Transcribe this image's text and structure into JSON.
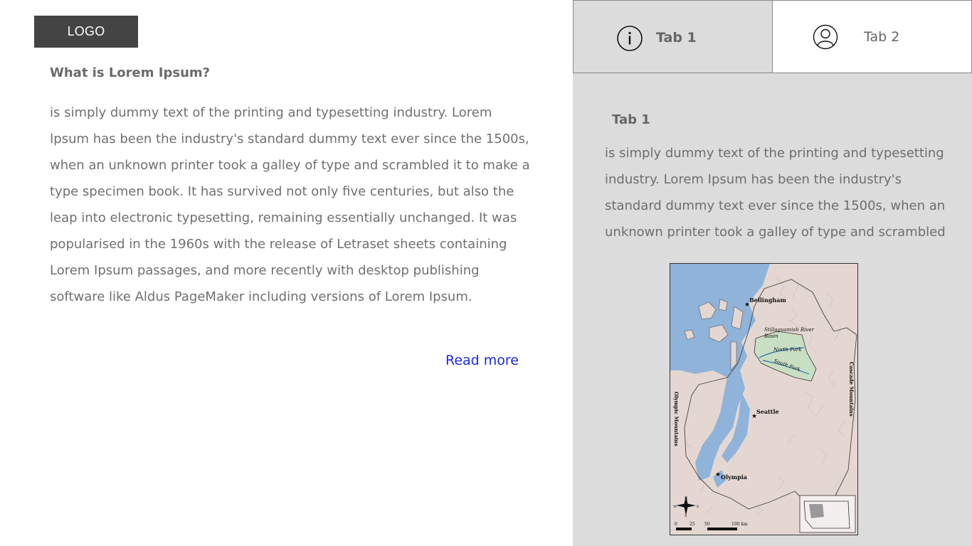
{
  "logo": {
    "label": "LOGO"
  },
  "article": {
    "title": "What is Lorem Ipsum?",
    "body": " is simply dummy text of the printing and typesetting industry. Lorem Ipsum has been the industry's standard dummy text ever since the 1500s, when an unknown printer took a galley of type and scrambled it to make a type specimen book. It has survived not only five centuries, but also the leap into electronic typesetting, remaining essentially unchanged. It was popularised in the 1960s with the release of Letraset sheets containing Lorem Ipsum passages, and more recently with desktop publishing software like Aldus PageMaker including versions of Lorem Ipsum.",
    "read_more": "Read more"
  },
  "tabs": [
    {
      "label": "Tab 1",
      "icon": "info-icon",
      "active": true
    },
    {
      "label": "Tab 2",
      "icon": "user-icon",
      "active": false
    }
  ],
  "tab_content": {
    "title": "Tab 1",
    "body": " is simply dummy text of the printing and typesetting industry. Lorem Ipsum has been the industry's standard dummy text ever since the 1500s, when an unknown printer took a galley of type and scrambled"
  },
  "map": {
    "labels": {
      "bellingham": "Bellingham",
      "basin_line1": "Stillaguamish River",
      "basin_line2": "Basin",
      "north_fork": "North Fork",
      "south_fork": "South Fork",
      "cascade": "Cascade Mountains",
      "olympic": "Olympic Mountains",
      "seattle": "Seattle",
      "olympia": "Olympia",
      "compass_n": "N",
      "compass_s": "S",
      "compass_e": "E",
      "compass_w": "W",
      "scale_0": "0",
      "scale_25": "25",
      "scale_50": "50",
      "scale_100": "100 km"
    }
  },
  "colors": {
    "logo_bg": "#444444",
    "link": "#1a2bdc",
    "panel_bg": "#dcdcdc",
    "water": "#8fb3d9",
    "basin": "#c9dfc3"
  }
}
